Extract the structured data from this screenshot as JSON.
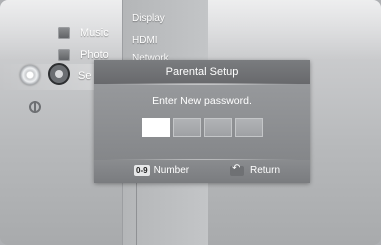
{
  "menu": {
    "items": [
      {
        "label": "Music",
        "icon": "music-icon"
      },
      {
        "label": "Photo",
        "icon": "photo-icon"
      },
      {
        "label": "Se",
        "icon": "settings-gear-icon"
      }
    ],
    "side_icons": [
      "disc-icon",
      "settings-gear-icon",
      "globe-icon"
    ]
  },
  "submenu": {
    "items": [
      "Display",
      "HDMI",
      "Network"
    ]
  },
  "dialog": {
    "title": "Parental Setup",
    "prompt": "Enter New password.",
    "password_boxes": 4,
    "active_box_index": 0,
    "footer": {
      "number_key": "0-9",
      "number_label": "Number",
      "return_label": "Return"
    }
  },
  "colors": {
    "background": "#c9cacc",
    "dialog": "#8e9093",
    "active_box": "#ffffff"
  }
}
